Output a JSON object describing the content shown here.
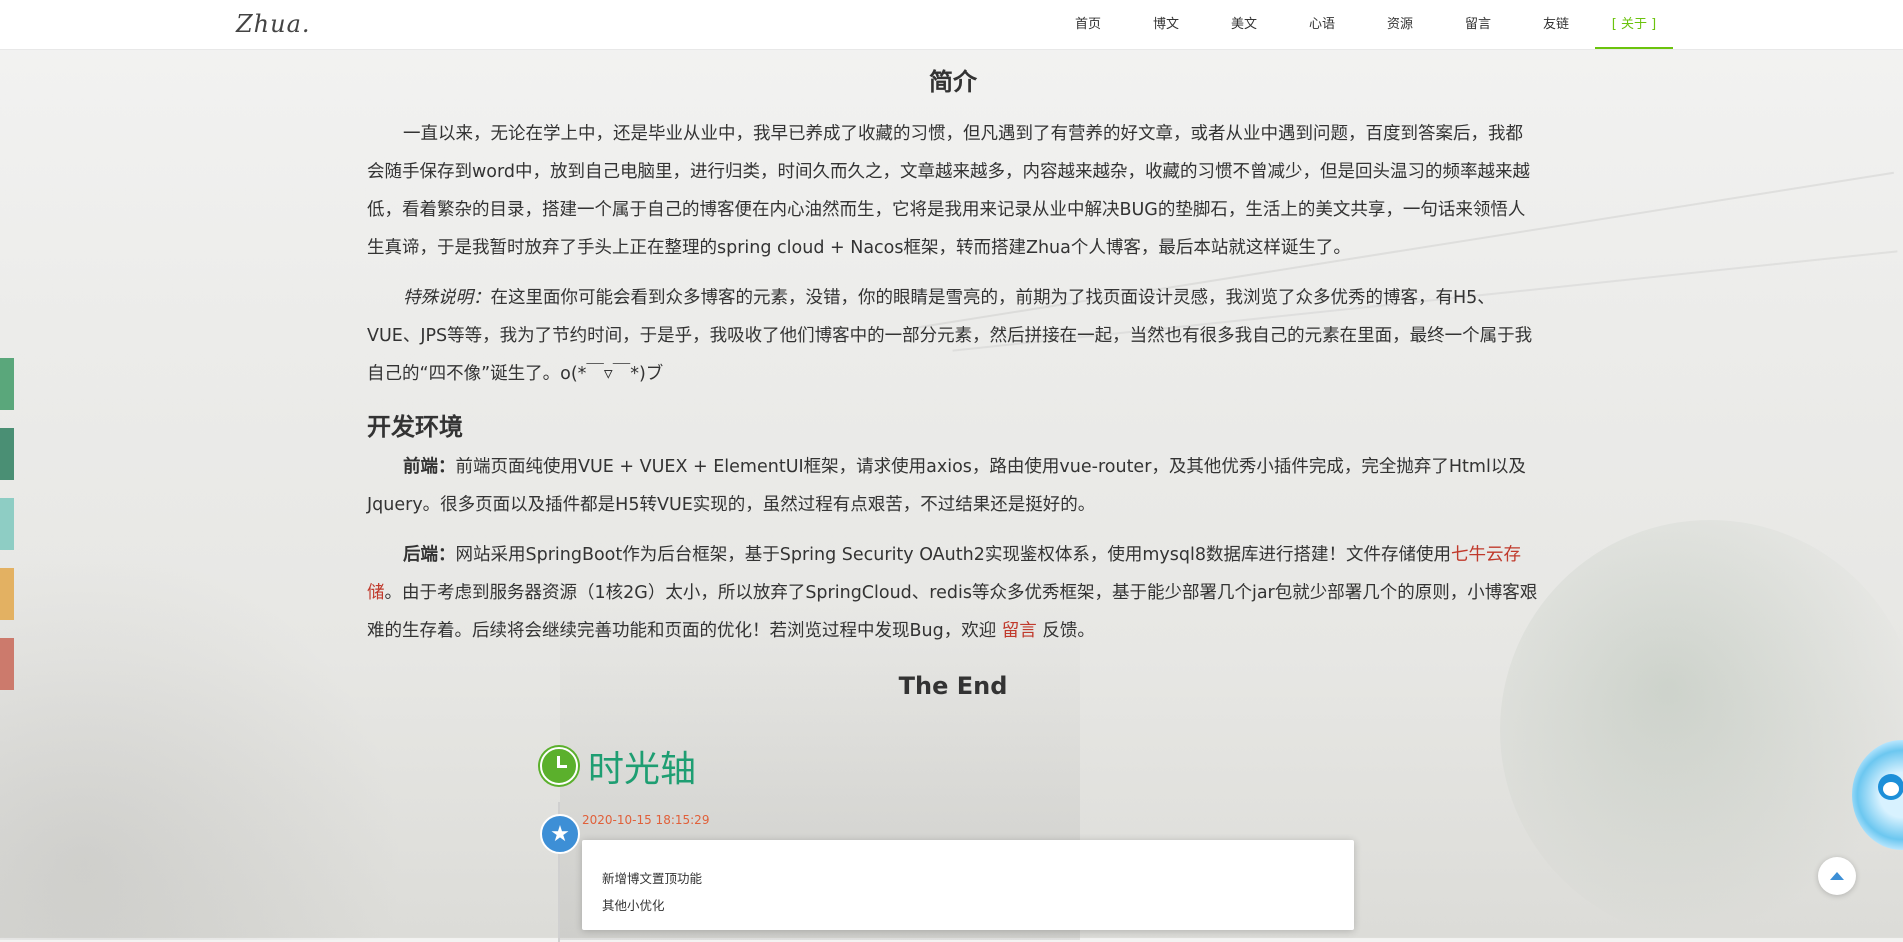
{
  "header": {
    "logo": "Zhua.",
    "nav": [
      "首页",
      "博文",
      "美文",
      "心语",
      "资源",
      "留言",
      "友链",
      "[ 关于 ]"
    ],
    "active_index": 7
  },
  "side_tabs": {
    "colors": [
      "#5aa77b",
      "#4a8f74",
      "#8ecdc4",
      "#e3b162",
      "#cc7a6c"
    ]
  },
  "intro": {
    "title": "简介",
    "p1": "一直以来，无论在学上中，还是毕业从业中，我早已养成了收藏的习惯，但凡遇到了有营养的好文章，或者从业中遇到问题，百度到答案后，我都会随手保存到word中，放到自己电脑里，进行归类，时间久而久之，文章越来越多，内容越来越杂，收藏的习惯不曾减少，但是回头温习的频率越来越低，看着繁杂的目录，搭建一个属于自己的博客便在内心油然而生，它将是我用来记录从业中解决BUG的垫脚石，生活上的美文共享，一句话来领悟人生真谛，于是我暂时放弃了手头上正在整理的spring cloud + Nacos框架，转而搭建Zhua个人博客，最后本站就这样诞生了。",
    "p2_label": "特殊说明：",
    "p2": "在这里面你可能会看到众多博客的元素，没错，你的眼睛是雪亮的，前期为了找页面设计灵感，我浏览了众多优秀的博客，有H5、VUE、JPS等等，我为了节约时间，于是乎，我吸收了他们博客中的一部分元素，然后拼接在一起，当然也有很多我自己的元素在里面，最终一个属于我自己的“四不像”诞生了。o(*￣▿￣*)ブ"
  },
  "env": {
    "title": "开发环境",
    "front_label": "前端：",
    "front_text": "前端页面纯使用VUE + VUEX + ElementUI框架，请求使用axios，路由使用vue-router，及其他优秀小插件完成，完全抛弃了Html以及Jquery。很多页面以及插件都是H5转VUE实现的，虽然过程有点艰苦，不过结果还是挺好的。",
    "back_label": "后端：",
    "back_text_1": "网站采用SpringBoot作为后台框架，基于Spring Security OAuth2实现鉴权体系，使用mysql8数据库进行搭建！文件存储使用",
    "back_link": "七牛云存储",
    "back_text_2": "。由于考虑到服务器资源（1核2G）太小，所以放弃了SpringCloud、redis等众多优秀框架，基于能少部署几个jar包就少部署几个的原则，小博客艰难的生存着。后续将会继续完善功能和页面的优化！若浏览过程中发现Bug，欢迎 ",
    "message_link": "留言",
    "back_text_3": " 反馈。"
  },
  "the_end": "The End",
  "timeline": {
    "title": "时光轴",
    "entries": [
      {
        "date": "2020-10-15 18:15:29",
        "lines": [
          "新增博文置顶功能",
          "其他小优化"
        ]
      }
    ]
  }
}
